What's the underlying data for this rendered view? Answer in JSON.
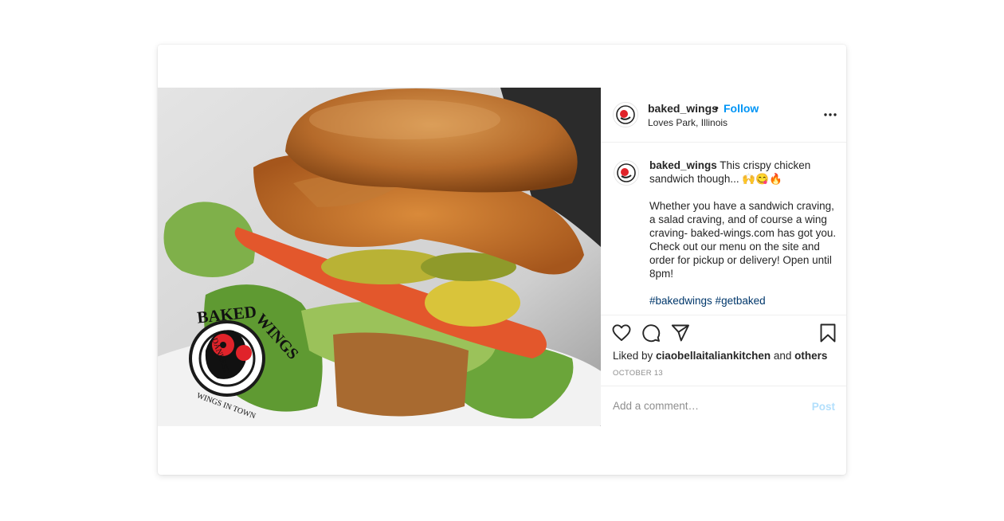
{
  "post": {
    "username": "baked_wings",
    "separator": "•",
    "follow_label": "Follow",
    "location": "Loves Park, Illinois",
    "more_icon": "more-horizontal-icon",
    "caption": {
      "username": "baked_wings",
      "line1": " This crispy chicken sandwich though... 🙌😋🔥",
      "paragraph2": "Whether you have a sandwich craving, a salad craving, and of course a wing craving- baked-wings.com has got you. Check out our menu on the site and order for pickup or delivery! Open until 8pm!",
      "hashtags": "#bakedwings #getbaked"
    },
    "actions": {
      "like_icon": "heart-icon",
      "comment_icon": "comment-icon",
      "share_icon": "share-icon",
      "save_icon": "bookmark-icon"
    },
    "likes": {
      "prefix": "Liked by ",
      "user": "ciaobellaitaliankitchen",
      "middle": " and ",
      "others": "others"
    },
    "date": "OCTOBER 13",
    "comment_placeholder": "Add a comment…",
    "post_label": "Post"
  },
  "image_logo": {
    "brand": "BAKED-WINGS",
    "tagline": "\"DANKEST WINGS IN TOWN\""
  },
  "colors": {
    "follow": "#0095f6",
    "hashtag": "#00376b",
    "post_disabled": "#b2dffc",
    "muted": "#8e8e8e"
  }
}
